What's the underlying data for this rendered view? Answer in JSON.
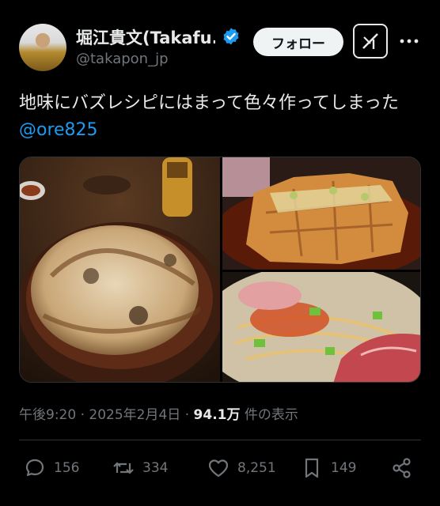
{
  "author": {
    "name": "堀江貴文(Takafu...",
    "handle": "@takapon_jp"
  },
  "follow_label": "フォロー",
  "tweet": {
    "text": "地味にバズレシピにはまって色々作ってしまった ",
    "mention": "@ore825"
  },
  "meta": {
    "time": "午後9:20",
    "separator1": " · ",
    "date": "2025年2月4日",
    "separator2": " · ",
    "views": "94.1万",
    "views_suffix": " 件の表示"
  },
  "actions": {
    "replies": "156",
    "reposts": "334",
    "likes": "8,251",
    "bookmarks": "149"
  },
  "colors": {
    "background": "#000000",
    "text": "#e7e9ea",
    "muted": "#71767b",
    "link": "#1d9bf0",
    "verified": "#1d9bf0"
  },
  "icons": [
    "verified-badge-icon",
    "grok-icon",
    "more-icon",
    "reply-icon",
    "repost-icon",
    "like-icon",
    "bookmark-icon",
    "share-icon"
  ]
}
